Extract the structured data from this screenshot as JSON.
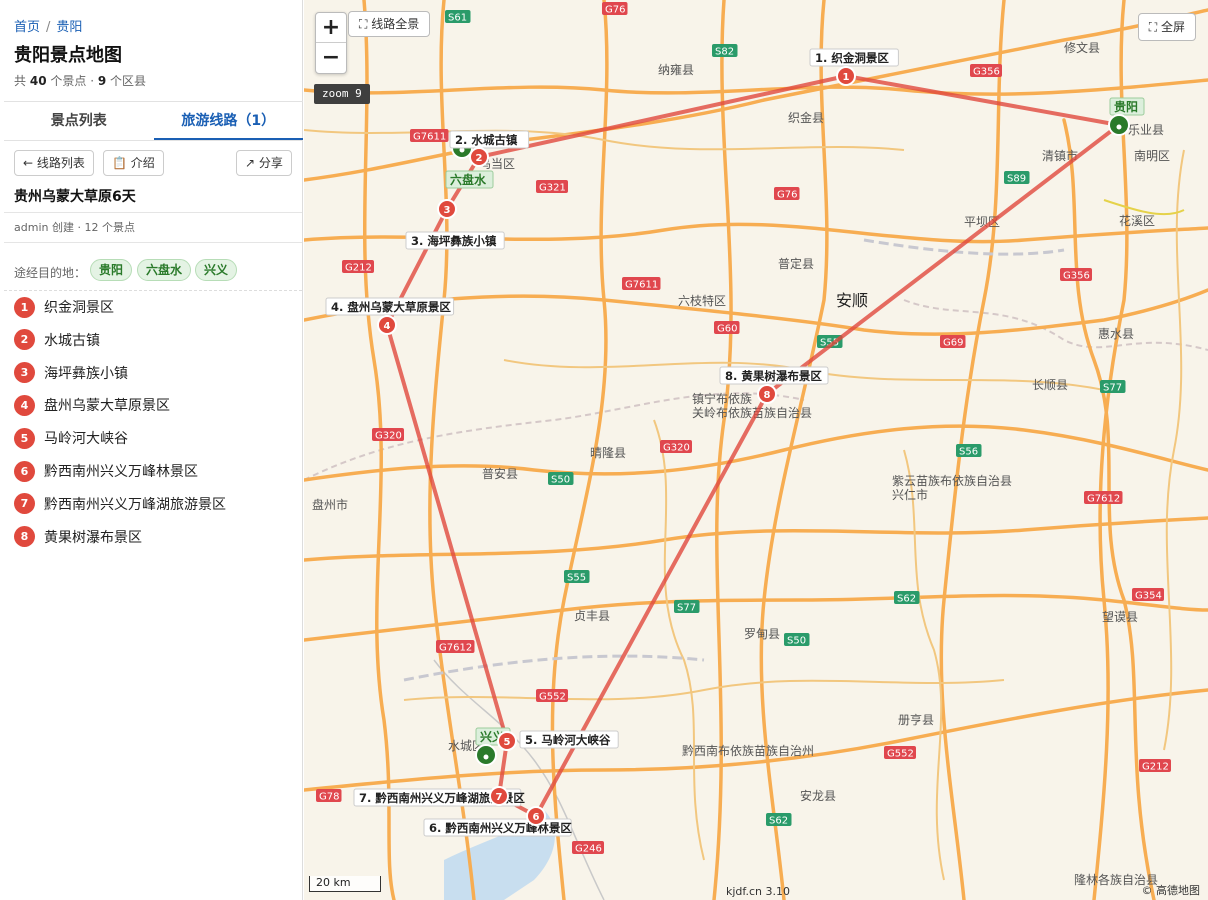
{
  "breadcrumb": {
    "home": "首页",
    "sep": "/",
    "current": "贵阳"
  },
  "page": {
    "title": "贵阳景点地图",
    "stats_prefix": "共",
    "spots": "40",
    "spots_mid": "个景点 ·",
    "districts": "9",
    "districts_suffix": "个区县"
  },
  "tabs": [
    {
      "label": "景点列表"
    },
    {
      "label": "旅游线路（1）"
    }
  ],
  "route_panel": {
    "back_label": "← 线路列表",
    "intro_label": "📋 介绍",
    "share_label": "↗ 分享",
    "route_name": "贵州乌蒙大草原6天",
    "meta": "admin 创建 · 12 个景点",
    "destinations_label": "途经目的地：",
    "destinations": [
      "贵阳",
      "六盘水",
      "兴义"
    ],
    "stops": [
      {
        "n": "1",
        "name": "织金洞景区"
      },
      {
        "n": "2",
        "name": "水城古镇"
      },
      {
        "n": "3",
        "name": "海坪彝族小镇"
      },
      {
        "n": "4",
        "name": "盘州乌蒙大草原景区"
      },
      {
        "n": "5",
        "name": "马岭河大峡谷"
      },
      {
        "n": "6",
        "name": "黔西南州兴义万峰林景区"
      },
      {
        "n": "7",
        "name": "黔西南州兴义万峰湖旅游景区"
      },
      {
        "n": "8",
        "name": "黄果树瀑布景区"
      }
    ]
  },
  "map": {
    "zoom_in": "+",
    "zoom_out": "−",
    "overview_label": "⛶ 线路全景",
    "fullscreen_label": "⛶ 全屏",
    "zoom_level": "zoom 9",
    "scale": "20 km",
    "version": "kjdf.cn 3.10",
    "copyright": "© 高德地图",
    "route_color": "#e0493d",
    "marker_color": "#e0493d",
    "city_marker_color": "#2a7a2a",
    "markers": [
      {
        "n": "1",
        "label": "1. 织金洞景区"
      },
      {
        "n": "2",
        "label": "2. 水城古镇"
      },
      {
        "n": "3",
        "label": "3. 海坪彝族小镇"
      },
      {
        "n": "4",
        "label": "4. 盘州乌蒙大草原景区"
      },
      {
        "n": "5",
        "label": "5. 马岭河大峡谷"
      },
      {
        "n": "6",
        "label": "6. 黔西南州兴义万峰林景区"
      },
      {
        "n": "7",
        "label": "7. 黔西南州兴义万峰湖旅游景区"
      },
      {
        "n": "8",
        "label": "8. 黄果树瀑布景区"
      }
    ],
    "city_markers": [
      {
        "label": "贵阳"
      },
      {
        "label": "六盘水"
      },
      {
        "label": "兴义"
      }
    ],
    "place_labels": [
      "修文县",
      "纳雍县",
      "织金县",
      "清镇市",
      "南明区",
      "花溪区",
      "平坝区",
      "普定县",
      "安顺",
      "六枝特区",
      "惠水县",
      "长顺县",
      "镇宁布依族",
      "关岭布依族苗族自治县",
      "晴隆县",
      "普安县",
      "盘州市",
      "紫云苗族布依族自治县",
      "兴仁市",
      "贞丰县",
      "罗甸县",
      "望谟县",
      "册亨县",
      "安龙县",
      "黔西南布依族苗族自治州",
      "水城区",
      "乌当区",
      "乐业县",
      "隆林各族自治县"
    ],
    "highway_shields": [
      "S61",
      "G76",
      "S82",
      "G356",
      "G7611",
      "G321",
      "G76",
      "S89",
      "G356",
      "G7611",
      "G60",
      "S55",
      "G69",
      "S77",
      "G320",
      "G320",
      "S50",
      "S56",
      "G212",
      "G7612",
      "S55",
      "S62",
      "G354",
      "S50",
      "S77",
      "G7612",
      "G552",
      "G552",
      "G212",
      "G78",
      "S62",
      "G246"
    ]
  }
}
